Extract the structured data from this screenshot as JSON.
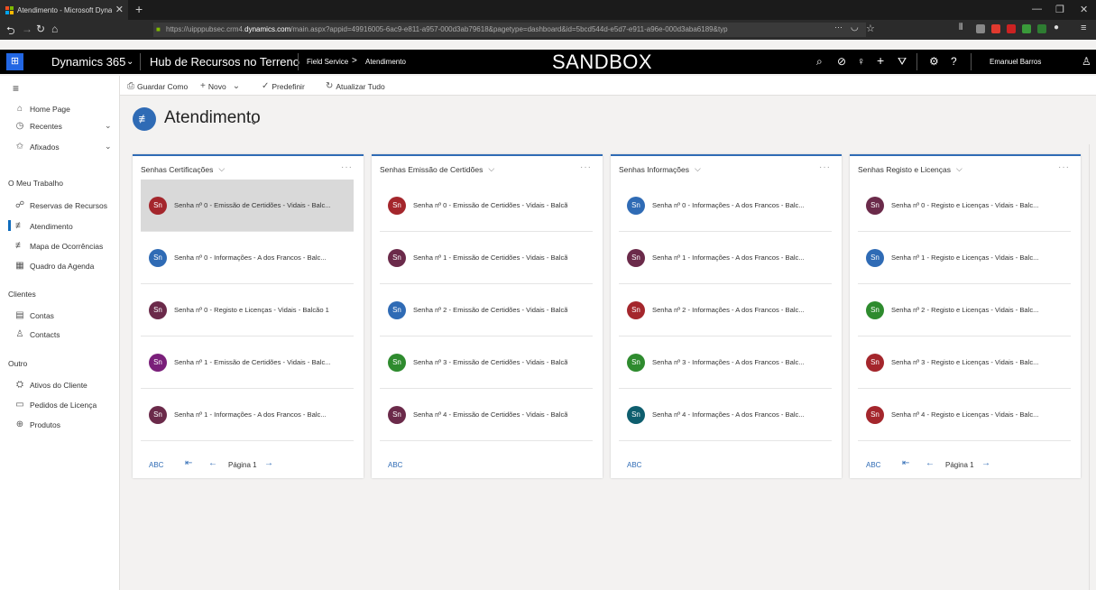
{
  "browser": {
    "tab_title": "Atendimento - Microsoft Dyna",
    "tab_close": "✕",
    "new_tab": "+",
    "url_prefix": "https://uipppubsec.crm4.",
    "url_domain": "dynamics.com",
    "url_rest": "/main.aspx?appid=49916005-6ac9-e811-a957-000d3ab79618&pagetype=dashboard&id=5bcd544d-e5d7-e911-a96e-000d3aba6189&typ",
    "url_more": "···"
  },
  "appbar": {
    "app_name": "Dynamics 365",
    "hub_title": "Hub de Recursos no Terreno",
    "breadcrumb_area": "Field Service",
    "breadcrumb_sep": ">",
    "breadcrumb_page": "Atendimento",
    "environment_banner": "SANDBOX",
    "user_name": "Emanuel Barros"
  },
  "commandbar": {
    "save_as": "Guardar Como",
    "new": "Novo",
    "set_default": "Predefinir",
    "refresh_all": "Atualizar Tudo"
  },
  "sidebar": {
    "home": "Home Page",
    "recent": "Recentes",
    "pinned": "Afixados",
    "section_work": "O Meu Trabalho",
    "work_items": [
      "Reservas de Recursos",
      "Atendimento",
      "Mapa de Ocorrências",
      "Quadro da Agenda"
    ],
    "section_clients": "Clientes",
    "client_items": [
      "Contas",
      "Contacts"
    ],
    "section_other": "Outro",
    "other_items": [
      "Ativos do Cliente",
      "Pedidos de Licença",
      "Produtos"
    ]
  },
  "dashboard": {
    "title": "Atendimento"
  },
  "panels": [
    {
      "title": "Senhas Certificações",
      "rows": [
        {
          "initials": "Sn",
          "color": "#a4262c",
          "text": "Senha nº 0 - Emissão de Certidões - Vidais - Balc..."
        },
        {
          "initials": "Sn",
          "color": "#2f6bb5",
          "text": "Senha nº 0 - Informações - A dos Francos - Balc..."
        },
        {
          "initials": "Sn",
          "color": "#6b2a4a",
          "text": "Senha nº 0 - Registo e Licenças - Vidais - Balcão 1"
        },
        {
          "initials": "Sn",
          "color": "#7a1f7a",
          "text": "Senha nº 1 - Emissão de Certidões - Vidais - Balc..."
        },
        {
          "initials": "Sn",
          "color": "#6b2a4a",
          "text": "Senha nº 1 - Informações - A dos Francos - Balc..."
        }
      ],
      "footer_abc": "ABC",
      "page_label": "Página 1"
    },
    {
      "title": "Senhas Emissão de Certidões",
      "rows": [
        {
          "initials": "Sn",
          "color": "#a4262c",
          "text": "Senha nº 0 - Emissão de Certidões - Vidais - Balcã"
        },
        {
          "initials": "Sn",
          "color": "#6b2a4a",
          "text": "Senha nº 1 - Emissão de Certidões - Vidais - Balcã"
        },
        {
          "initials": "Sn",
          "color": "#2f6bb5",
          "text": "Senha nº 2 - Emissão de Certidões - Vidais - Balcã"
        },
        {
          "initials": "Sn",
          "color": "#2e8b2e",
          "text": "Senha nº 3 - Emissão de Certidões - Vidais - Balcã"
        },
        {
          "initials": "Sn",
          "color": "#6b2a4a",
          "text": "Senha nº 4 - Emissão de Certidões - Vidais - Balcã"
        }
      ],
      "footer_abc": "ABC"
    },
    {
      "title": "Senhas Informações",
      "rows": [
        {
          "initials": "Sn",
          "color": "#2f6bb5",
          "text": "Senha nº 0 - Informações - A dos Francos - Balc..."
        },
        {
          "initials": "Sn",
          "color": "#6b2a4a",
          "text": "Senha nº 1 - Informações - A dos Francos - Balc..."
        },
        {
          "initials": "Sn",
          "color": "#a4262c",
          "text": "Senha nº 2 - Informações - A dos Francos - Balc..."
        },
        {
          "initials": "Sn",
          "color": "#2e8b2e",
          "text": "Senha nº 3 - Informações - A dos Francos - Balc..."
        },
        {
          "initials": "Sn",
          "color": "#0e5e6e",
          "text": "Senha nº 4 - Informações - A dos Francos - Balc..."
        }
      ],
      "footer_abc": "ABC"
    },
    {
      "title": "Senhas Registo e Licenças",
      "rows": [
        {
          "initials": "Sn",
          "color": "#6b2a4a",
          "text": "Senha nº 0 - Registo e Licenças - Vidais - Balc..."
        },
        {
          "initials": "Sn",
          "color": "#2f6bb5",
          "text": "Senha nº 1 - Registo e Licenças - Vidais - Balc..."
        },
        {
          "initials": "Sn",
          "color": "#2e8b2e",
          "text": "Senha nº 2 - Registo e Licenças - Vidais - Balc..."
        },
        {
          "initials": "Sn",
          "color": "#a4262c",
          "text": "Senha nº 3 - Registo e Licenças - Vidais - Balc..."
        },
        {
          "initials": "Sn",
          "color": "#a4262c",
          "text": "Senha nº 4 - Registo e Licenças - Vidais - Balc..."
        }
      ],
      "footer_abc": "ABC",
      "page_label": "Página 1"
    }
  ],
  "icons": {
    "waffle": "⊞",
    "more": "···"
  }
}
